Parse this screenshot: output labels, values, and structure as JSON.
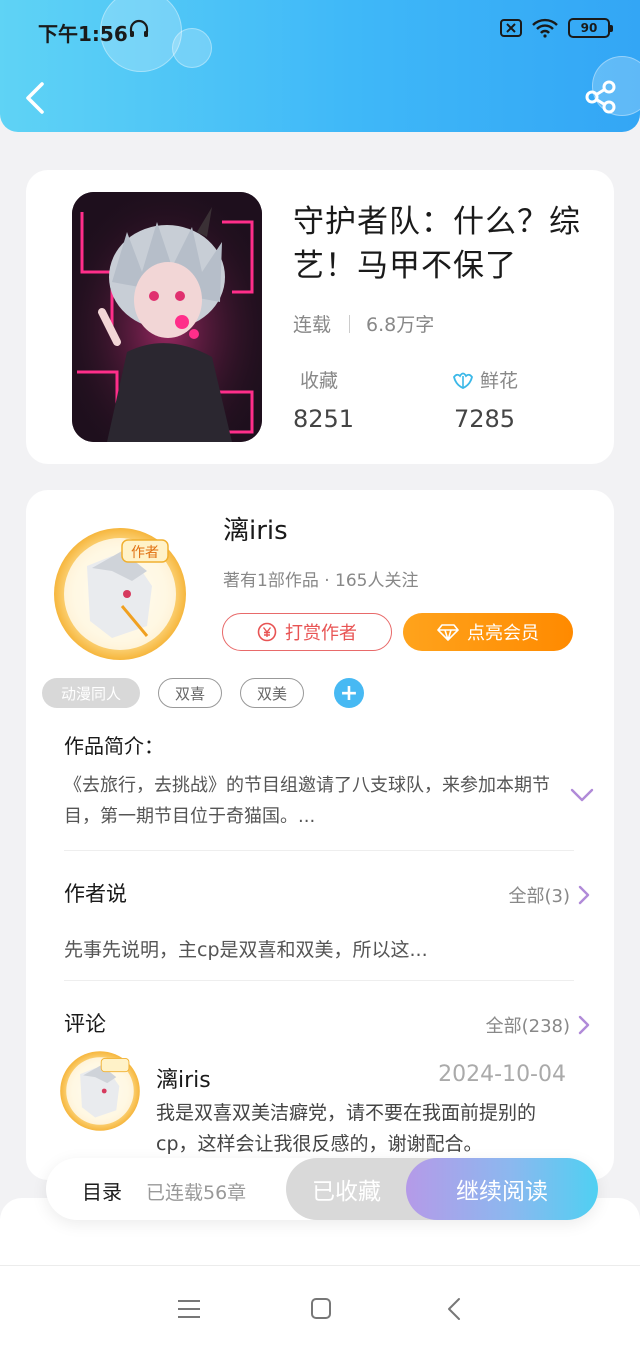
{
  "status_bar": {
    "time": "下午1:56",
    "battery": "90"
  },
  "book": {
    "title": "守护者队：什么？综艺！马甲不保了",
    "status": "连载",
    "word_count": "6.8万字",
    "stats": {
      "collect_label": "收藏",
      "collect_value": "8251",
      "flower_label": "鲜花",
      "flower_value": "7285"
    }
  },
  "author": {
    "name": "漓iris",
    "meta": "著有1部作品 · 165人关注",
    "tip_label": "打赏作者",
    "vip_label": "点亮会员",
    "avatar_badge": "作者"
  },
  "tags": [
    {
      "label": "动漫同人"
    },
    {
      "label": "双喜"
    },
    {
      "label": "双美"
    }
  ],
  "intro": {
    "title": "作品简介：",
    "text": "《去旅行，去挑战》的节目组邀请了八支球队，来参加本期节目，第一期节目位于奇猫国。..."
  },
  "author_say": {
    "title": "作者说",
    "more": "全部(3)",
    "text": "先事先说明，主cp是双喜和双美，所以这..."
  },
  "comments": {
    "title": "评论",
    "more": "全部(238)",
    "items": [
      {
        "user": "漓iris",
        "date": "2024-10-04",
        "text": "我是双喜双美洁癖党，请不要在我面前提别的cp，这样会让我很反感的，谢谢配合。"
      }
    ]
  },
  "action_bar": {
    "toc_label": "目录",
    "toc_count": "已连载56章",
    "collected_label": "已收藏",
    "read_label": "继续阅读"
  },
  "colors": {
    "header_start": "#5fd3f5",
    "header_end": "#33a6f5",
    "vip_orange": "#ff8a00",
    "tip_red": "#e85454",
    "accent_purple": "#b59ae8"
  }
}
